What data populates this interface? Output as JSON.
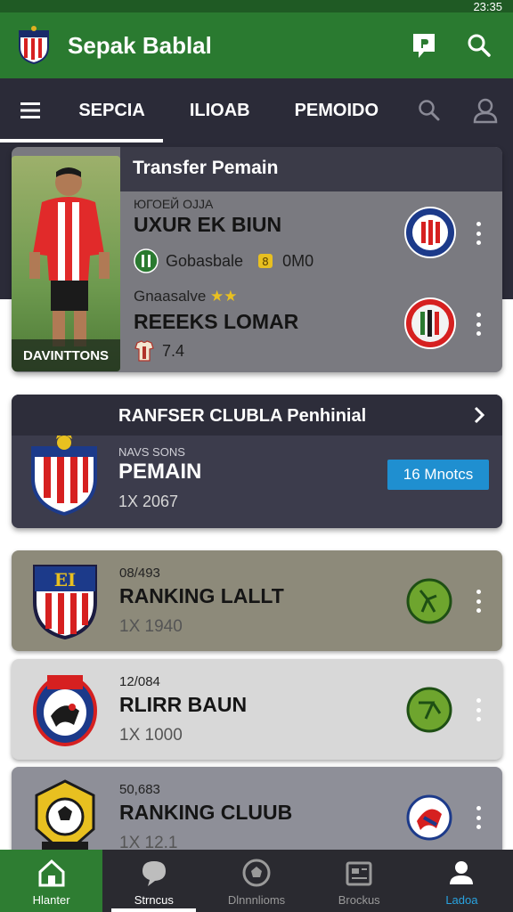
{
  "status_bar": {
    "time": "23:35"
  },
  "app_bar": {
    "title": "Sepak Bablal"
  },
  "tabs": [
    {
      "label": "SEPCIA",
      "active": true
    },
    {
      "label": "ILIOAB",
      "active": false
    },
    {
      "label": "PEMOIDO",
      "active": false
    }
  ],
  "featured": {
    "heading": "Transfer Pemain",
    "photo_caption": "DAVINTTONS",
    "entry1": {
      "small": "ЮГОЕЙ ОЈЈА",
      "name": "UXUR EK BIUN",
      "club": "Gobasbale",
      "fee": "0M0"
    },
    "entry2": {
      "small": "Gnaasalve",
      "name": "REEEKS LOMAR",
      "value": "7.4"
    }
  },
  "club_transfer": {
    "heading": "RANFSER CLUBLA Penhinial",
    "small": "NAVS SONS",
    "title": "PEMAIN",
    "meta": "1X 2067",
    "badge": "16 Mnotcs"
  },
  "rankings": [
    {
      "small": "08/493",
      "title": "RANKING LALLT",
      "meta": "1X 1940"
    },
    {
      "small": "12/084",
      "title": "RLIRR BAUN",
      "meta": "1X 1000"
    },
    {
      "small": "50,683",
      "title": "RANKING CLUUB",
      "meta": "1X 12.1"
    }
  ],
  "bottom_nav": [
    {
      "label": "Hlanter",
      "icon": "home-icon"
    },
    {
      "label": "Strncus",
      "icon": "chat-icon"
    },
    {
      "label": "Dlnnnlioms",
      "icon": "ball-icon"
    },
    {
      "label": "Brockus",
      "icon": "news-icon"
    },
    {
      "label": "Ladoa",
      "icon": "profile-icon"
    }
  ],
  "colors": {
    "primary": "#2a7a30",
    "dark": "#2b2b38",
    "accent": "#1f8fd0"
  }
}
